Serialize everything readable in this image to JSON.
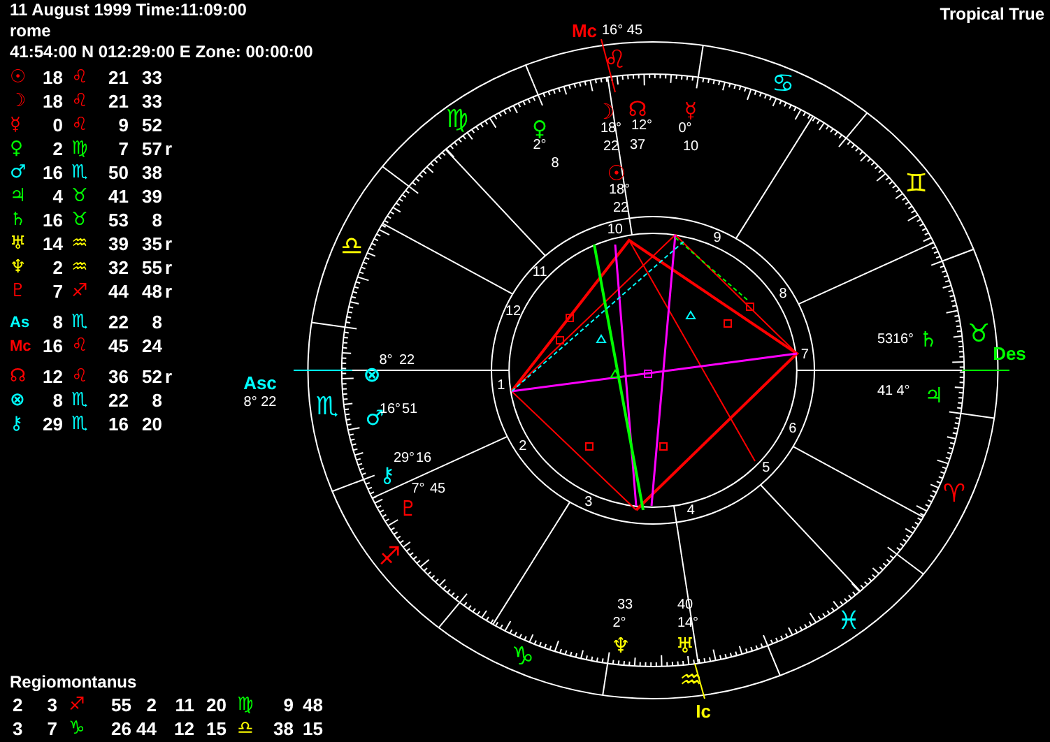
{
  "header": {
    "date_time": "11 August 1999 Time:11:09:00",
    "place": "rome",
    "coordinates": "41:54:00 N 012:29:00 E Zone: 00:00:00",
    "zodiac": "Tropical True"
  },
  "positions": [
    {
      "kind": "planet",
      "symbol": "☉",
      "color": "#ff0000",
      "degree": "18",
      "sign": {
        "symbol": "♌",
        "color": "#ff0000"
      },
      "minutes": "21",
      "seconds": "33"
    },
    {
      "kind": "planet",
      "symbol": "☽",
      "color": "#ff0000",
      "degree": "18",
      "sign": {
        "symbol": "♌",
        "color": "#ff0000"
      },
      "minutes": "21",
      "seconds": "33"
    },
    {
      "kind": "planet",
      "symbol": "☿",
      "color": "#ff0000",
      "degree": "0",
      "sign": {
        "symbol": "♌",
        "color": "#ff0000"
      },
      "minutes": "9",
      "seconds": "52"
    },
    {
      "kind": "planet",
      "symbol": "♀",
      "color": "#00ff00",
      "degree": "2",
      "sign": {
        "symbol": "♍",
        "color": "#00ff00"
      },
      "minutes": "7",
      "seconds": "57",
      "flag": "r"
    },
    {
      "kind": "planet",
      "symbol": "♂",
      "color": "#00ffff",
      "degree": "16",
      "sign": {
        "symbol": "♏",
        "color": "#00ffff"
      },
      "minutes": "50",
      "seconds": "38"
    },
    {
      "kind": "planet",
      "symbol": "♃",
      "color": "#00ff00",
      "degree": "4",
      "sign": {
        "symbol": "♉",
        "color": "#00ff00"
      },
      "minutes": "41",
      "seconds": "39"
    },
    {
      "kind": "planet",
      "symbol": "♄",
      "color": "#00ff00",
      "degree": "16",
      "sign": {
        "symbol": "♉",
        "color": "#00ff00"
      },
      "minutes": "53",
      "seconds": "8"
    },
    {
      "kind": "planet",
      "symbol": "♅",
      "color": "#ffff00",
      "degree": "14",
      "sign": {
        "symbol": "♒",
        "color": "#ffff00"
      },
      "minutes": "39",
      "seconds": "35",
      "flag": "r"
    },
    {
      "kind": "planet",
      "symbol": "♆",
      "color": "#ffff00",
      "degree": "2",
      "sign": {
        "symbol": "♒",
        "color": "#ffff00"
      },
      "minutes": "32",
      "seconds": "55",
      "flag": "r"
    },
    {
      "kind": "planet",
      "symbol": "♇",
      "color": "#ff0000",
      "degree": "7",
      "sign": {
        "symbol": "♐",
        "color": "#ff0000"
      },
      "minutes": "44",
      "seconds": "48",
      "flag": "r"
    },
    {
      "kind": "angle",
      "symbol": "As",
      "color": "#00ffff",
      "degree": "8",
      "sign": {
        "symbol": "♏",
        "color": "#00ffff"
      },
      "minutes": "22",
      "seconds": "8"
    },
    {
      "kind": "angle",
      "symbol": "Mc",
      "color": "#ff0000",
      "degree": "16",
      "sign": {
        "symbol": "♌",
        "color": "#ff0000"
      },
      "minutes": "45",
      "seconds": "24"
    },
    {
      "kind": "point",
      "symbol": "☊",
      "color": "#ff0000",
      "degree": "12",
      "sign": {
        "symbol": "♌",
        "color": "#ff0000"
      },
      "minutes": "36",
      "seconds": "52",
      "flag": "r"
    },
    {
      "kind": "point",
      "symbol": "⊗",
      "color": "#00ffff",
      "degree": "8",
      "sign": {
        "symbol": "♏",
        "color": "#00ffff"
      },
      "minutes": "22",
      "seconds": "8"
    },
    {
      "kind": "point",
      "symbol": "⚷",
      "color": "#00ffff",
      "degree": "29",
      "sign": {
        "symbol": "♏",
        "color": "#00ffff"
      },
      "minutes": "16",
      "seconds": "20"
    }
  ],
  "houses": {
    "system": "Regiomontanus",
    "rows": [
      {
        "cells": [
          {
            "text": "2"
          },
          {
            "text": "3"
          },
          {
            "text": "♐",
            "color": "#ff0000"
          },
          {
            "text": "55"
          },
          {
            "text": "2"
          },
          {
            "text": "11"
          },
          {
            "text": "20"
          },
          {
            "text": "♍",
            "color": "#00ff00"
          },
          {
            "text": "9"
          },
          {
            "text": "48"
          }
        ]
      },
      {
        "cells": [
          {
            "text": "3"
          },
          {
            "text": "7"
          },
          {
            "text": "♑",
            "color": "#00ff00"
          },
          {
            "text": "26"
          },
          {
            "text": "44"
          },
          {
            "text": "12"
          },
          {
            "text": "15"
          },
          {
            "text": "♎",
            "color": "#ffff00"
          },
          {
            "text": "38"
          },
          {
            "text": "15"
          }
        ]
      }
    ]
  },
  "wheel": {
    "signs": [
      {
        "symbol": "♈",
        "color": "#ff0000"
      },
      {
        "symbol": "♉",
        "color": "#00ff00"
      },
      {
        "symbol": "♊",
        "color": "#ffff00"
      },
      {
        "symbol": "♋",
        "color": "#00ffff"
      },
      {
        "symbol": "♌",
        "color": "#ff0000"
      },
      {
        "symbol": "♍",
        "color": "#00ff00"
      },
      {
        "symbol": "♎",
        "color": "#ffff00"
      },
      {
        "symbol": "♏",
        "color": "#00ffff"
      },
      {
        "symbol": "♐",
        "color": "#ff0000"
      },
      {
        "symbol": "♑",
        "color": "#00ff00"
      },
      {
        "symbol": "♒",
        "color": "#ffff00"
      },
      {
        "symbol": "♓",
        "color": "#00ffff"
      }
    ],
    "house_numbers": [
      "1",
      "2",
      "3",
      "4",
      "5",
      "6",
      "7",
      "8",
      "9",
      "10",
      "11",
      "12"
    ],
    "angles": [
      {
        "label": "Asc",
        "color": "#00ffff",
        "value": "8° 22"
      },
      {
        "label": "Mc",
        "color": "#ff0000",
        "value": "16° 45"
      },
      {
        "label": "Des",
        "color": "#00ff00"
      },
      {
        "label": "Ic",
        "color": "#ffff00"
      }
    ],
    "planets": [
      {
        "symbol": "☽",
        "color": "#ff0000",
        "degree": "18°",
        "minutes": "22"
      },
      {
        "symbol": "☊",
        "color": "#ff0000",
        "degree": "12°",
        "minutes": "37"
      },
      {
        "symbol": "☿",
        "color": "#ff0000",
        "degree": "0°",
        "minutes": "10"
      },
      {
        "symbol": "♀",
        "color": "#00ff00",
        "degree": "2°",
        "minutes": "8"
      },
      {
        "symbol": "☉",
        "color": "#ff0000",
        "degree": "18°",
        "minutes": "22"
      },
      {
        "symbol": "⊗",
        "color": "#00ffff",
        "degree": "8°",
        "minutes": "22"
      },
      {
        "symbol": "♂",
        "color": "#00ffff",
        "degree": "16°",
        "minutes": "51"
      },
      {
        "symbol": "⚷",
        "color": "#00ffff",
        "degree": "29°",
        "minutes": "16"
      },
      {
        "symbol": "♇",
        "color": "#ff0000",
        "degree": "7°",
        "minutes": "45"
      },
      {
        "symbol": "♄",
        "color": "#00ff00",
        "degree": "16°",
        "minutes": "53"
      },
      {
        "symbol": "♃",
        "color": "#00ff00",
        "degree": "4°",
        "minutes": "41"
      },
      {
        "symbol": "♆",
        "color": "#ffff00",
        "degree": "2°",
        "minutes": "33"
      },
      {
        "symbol": "♅",
        "color": "#ffff00",
        "degree": "14°",
        "minutes": "40"
      }
    ]
  }
}
